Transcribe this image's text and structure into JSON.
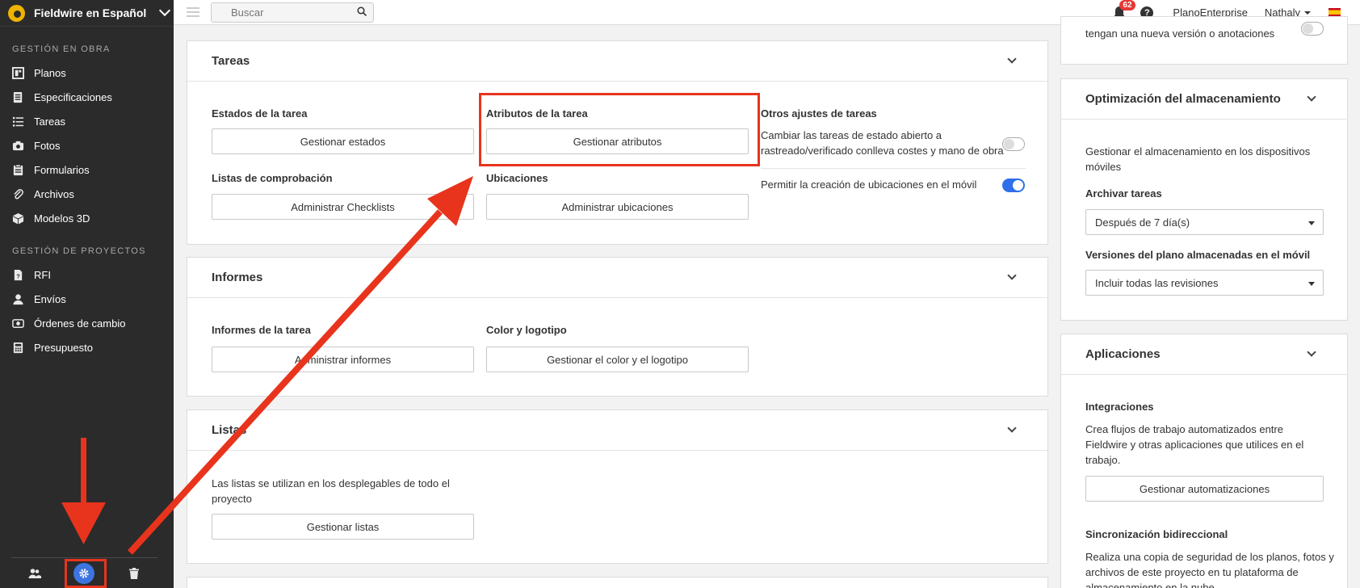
{
  "sidebar": {
    "brand": "Fieldwire en Español",
    "section_obra": "GESTIÓN EN OBRA",
    "obra_items": [
      {
        "label": "Planos",
        "icon": "plans-icon"
      },
      {
        "label": "Especificaciones",
        "icon": "specs-icon"
      },
      {
        "label": "Tareas",
        "icon": "tasks-icon"
      },
      {
        "label": "Fotos",
        "icon": "camera-icon"
      },
      {
        "label": "Formularios",
        "icon": "forms-icon"
      },
      {
        "label": "Archivos",
        "icon": "paperclip-icon"
      },
      {
        "label": "Modelos 3D",
        "icon": "cube-icon"
      }
    ],
    "section_proyectos": "GESTIÓN DE PROYECTOS",
    "proyecto_items": [
      {
        "label": "RFI",
        "icon": "rfi-icon"
      },
      {
        "label": "Envíos",
        "icon": "user-icon"
      },
      {
        "label": "Órdenes de cambio",
        "icon": "change-orders-icon"
      },
      {
        "label": "Presupuesto",
        "icon": "calculator-icon"
      }
    ]
  },
  "topbar": {
    "search_placeholder": "Buscar",
    "notifications_count": "62",
    "help": "?",
    "company": "PlanoEnterprise",
    "user": "Nathaly"
  },
  "tareas": {
    "title": "Tareas",
    "estados_label": "Estados de la tarea",
    "estados_btn": "Gestionar estados",
    "atributos_label": "Atributos de la tarea",
    "atributos_btn": "Gestionar atributos",
    "listas_label": "Listas de comprobación",
    "listas_btn": "Administrar Checklists",
    "ubicaciones_label": "Ubicaciones",
    "ubicaciones_btn": "Administrar ubicaciones",
    "otros_label": "Otros ajustes de tareas",
    "setting1_line1": "Cambiar las tareas de estado abierto a",
    "setting1_line2": "rastreado/verificado conlleva costes y mano de obra",
    "setting1_on": false,
    "setting2": "Permitir la creación de ubicaciones en el móvil",
    "setting2_on": true
  },
  "informes": {
    "title": "Informes",
    "informes_label": "Informes de la tarea",
    "informes_btn": "Administrar informes",
    "color_label": "Color y logotipo",
    "color_btn": "Gestionar el color y el logotipo"
  },
  "listas": {
    "title": "Listas",
    "desc_line1": "Las listas se utilizan en los desplegables de todo el",
    "desc_line2": "proyecto",
    "btn": "Gestionar listas"
  },
  "right": {
    "top_text": "tengan una nueva versión o anotaciones",
    "storage_title": "Optimización del almacenamiento",
    "storage_desc_line1": "Gestionar el almacenamiento en los dispositivos",
    "storage_desc_line2": "móviles",
    "archivar_label": "Archivar tareas",
    "archivar_value": "Después de 7 día(s)",
    "versiones_label": "Versiones del plano almacenadas en el móvil",
    "versiones_value": "Incluir todas las revisiones",
    "apps_title": "Aplicaciones",
    "integraciones_label": "Integraciones",
    "integraciones_line1": "Crea flujos de trabajo automatizados entre",
    "integraciones_line2": "Fieldwire y otras aplicaciones que utilices en el",
    "integraciones_line3": "trabajo.",
    "integraciones_btn": "Gestionar automatizaciones",
    "sync_label": "Sincronización bidireccional",
    "sync_line1": "Realiza una copia de seguridad de los planos, fotos y",
    "sync_line2": "archivos de este proyecto en tu plataforma de",
    "sync_line3": "almacenamiento en la nube"
  },
  "colors": {
    "sidebar_bg": "#2b2b2b",
    "accent_blue": "#2f6fea",
    "annotation_red": "#e8341c",
    "brand_yellow": "#f0b400"
  }
}
